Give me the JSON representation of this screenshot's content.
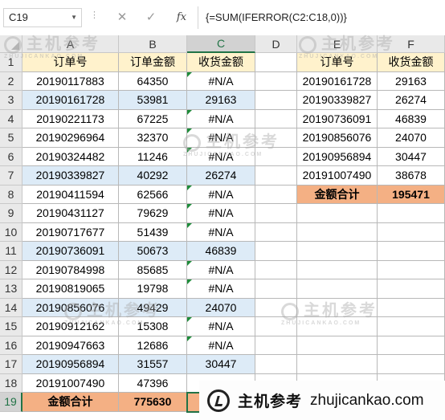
{
  "formula_bar": {
    "name_box": "C19",
    "cancel_icon": "✕",
    "enter_icon": "✓",
    "fx_label": "fx",
    "formula": "{=SUM(IFERROR(C2:C18,0))}"
  },
  "columns": [
    "A",
    "B",
    "C",
    "D",
    "E",
    "F"
  ],
  "rows": [
    "1",
    "2",
    "3",
    "4",
    "5",
    "6",
    "7",
    "8",
    "9",
    "10",
    "11",
    "12",
    "13",
    "14",
    "15",
    "16",
    "17",
    "18",
    "19"
  ],
  "left_table": {
    "headers": [
      "订单号",
      "订单金额",
      "收货金额"
    ],
    "rows": [
      [
        "20190117883",
        "64350",
        "#N/A"
      ],
      [
        "20190161728",
        "53981",
        "29163"
      ],
      [
        "20190221173",
        "67225",
        "#N/A"
      ],
      [
        "20190296964",
        "32370",
        "#N/A"
      ],
      [
        "20190324482",
        "11246",
        "#N/A"
      ],
      [
        "20190339827",
        "40292",
        "26274"
      ],
      [
        "20190411594",
        "62566",
        "#N/A"
      ],
      [
        "20190431127",
        "79629",
        "#N/A"
      ],
      [
        "20190717677",
        "51439",
        "#N/A"
      ],
      [
        "20190736091",
        "50673",
        "46839"
      ],
      [
        "20190784998",
        "85685",
        "#N/A"
      ],
      [
        "20190819065",
        "19798",
        "#N/A"
      ],
      [
        "20190856076",
        "49429",
        "24070"
      ],
      [
        "20190912162",
        "15308",
        "#N/A"
      ],
      [
        "20190947663",
        "12686",
        "#N/A"
      ],
      [
        "20190956894",
        "31557",
        "30447"
      ],
      [
        "20191007490",
        "47396",
        ""
      ]
    ],
    "total": [
      "金额合计",
      "775630",
      ""
    ]
  },
  "right_table": {
    "headers": [
      "订单号",
      "收货金额"
    ],
    "rows": [
      [
        "20190161728",
        "29163"
      ],
      [
        "20190339827",
        "26274"
      ],
      [
        "20190736091",
        "46839"
      ],
      [
        "20190856076",
        "24070"
      ],
      [
        "20190956894",
        "30447"
      ],
      [
        "20191007490",
        "38678"
      ]
    ],
    "total": [
      "金额合计",
      "195471"
    ]
  },
  "watermark": {
    "brand": "主机参考",
    "pinyin": "ZHUJICANKAO.COM",
    "url": "zhujicankao.com"
  },
  "colors": {
    "header_fill": "#fff2cc",
    "band_fill": "#ddebf7",
    "total_fill": "#f4b084",
    "selection": "#217346"
  }
}
